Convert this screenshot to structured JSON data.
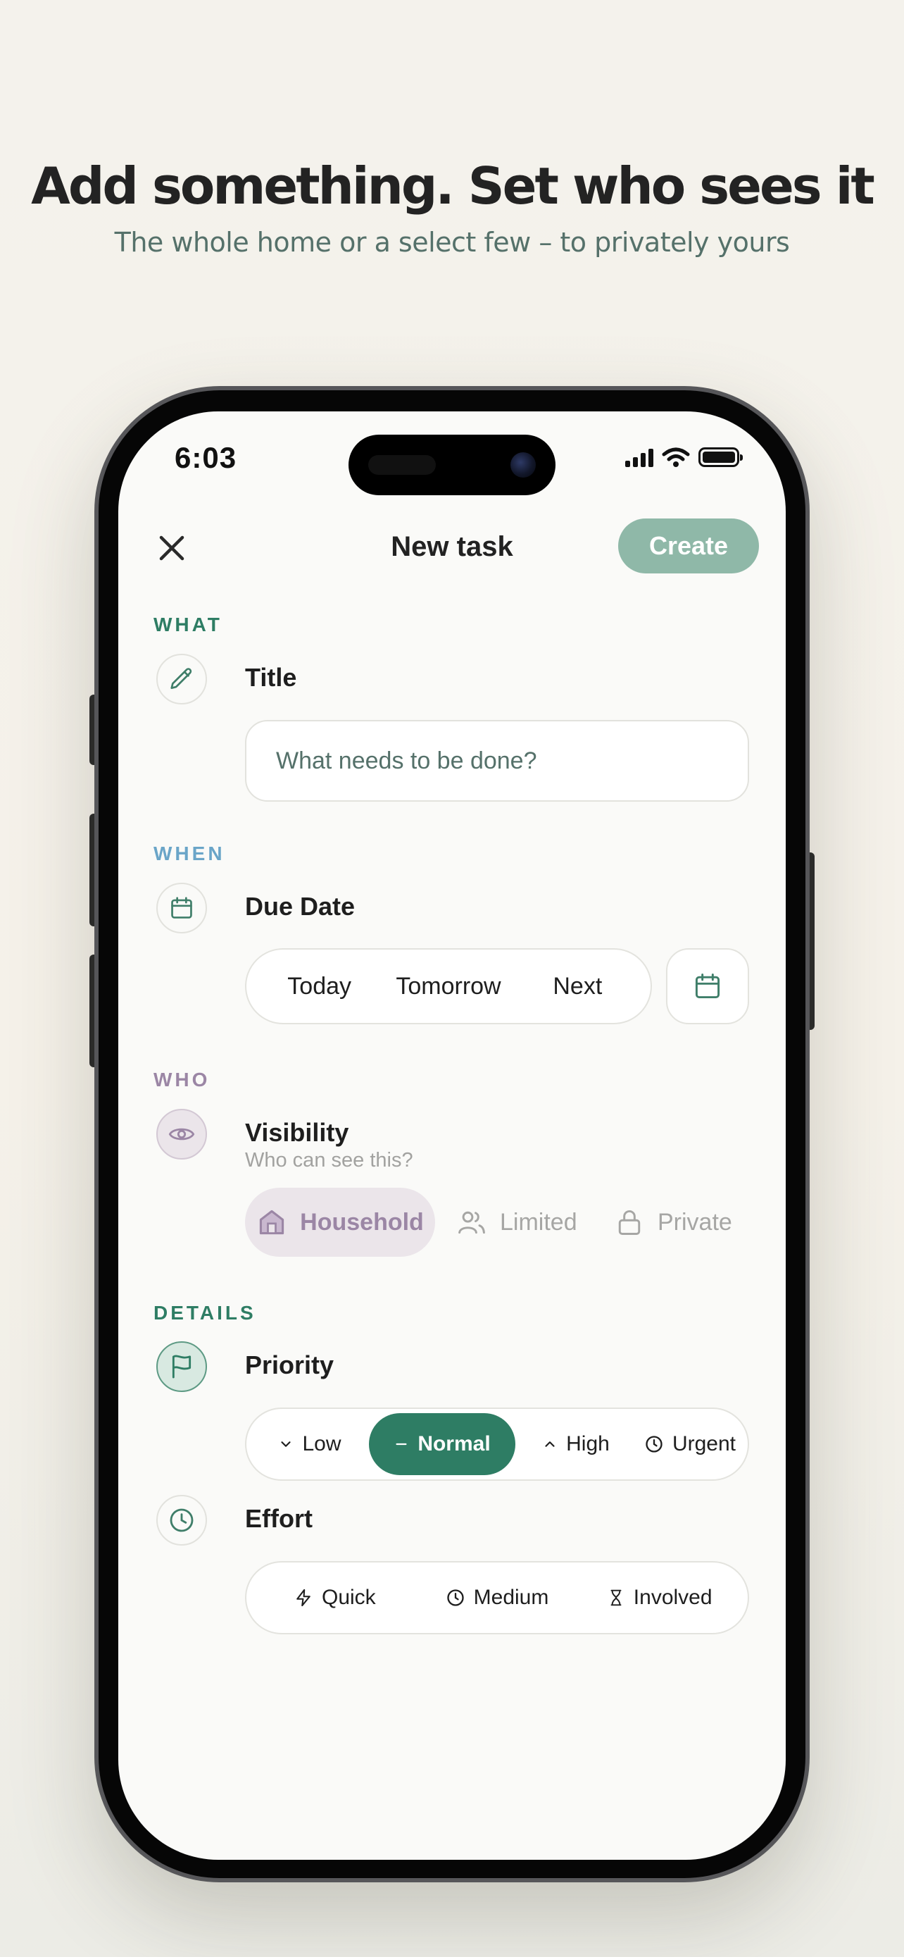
{
  "marketing": {
    "headline": "Add something. Set who sees it",
    "subline": "The whole home or a select few – to privately yours"
  },
  "status_bar": {
    "time": "6:03",
    "icons": [
      "cellular-signal-icon",
      "wifi-icon",
      "battery-icon"
    ]
  },
  "nav": {
    "close_icon": "close-icon",
    "title": "New task",
    "create_label": "Create"
  },
  "what": {
    "section_label": "WHAT",
    "icon": "pencil-icon",
    "field_title": "Title",
    "input_value": "",
    "input_placeholder": "What needs to be done?"
  },
  "when": {
    "section_label": "WHEN",
    "icon": "calendar-icon",
    "field_title": "Due Date",
    "options": [
      "Today",
      "Tomorrow",
      "Next"
    ],
    "picker_icon": "calendar-icon"
  },
  "who": {
    "section_label": "WHO",
    "icon": "eye-icon",
    "field_title": "Visibility",
    "hint": "Who can see this?",
    "options": [
      {
        "label": "Household",
        "icon": "home-icon",
        "selected": true
      },
      {
        "label": "Limited",
        "icon": "users-icon",
        "selected": false
      },
      {
        "label": "Private",
        "icon": "lock-icon",
        "selected": false
      }
    ]
  },
  "details": {
    "section_label": "DETAILS",
    "priority": {
      "icon": "flag-icon",
      "field_title": "Priority",
      "options": [
        {
          "label": "Low",
          "icon": "chevron-down-icon",
          "selected": false
        },
        {
          "label": "Normal",
          "icon": "minus-icon",
          "selected": true
        },
        {
          "label": "High",
          "icon": "chevron-up-icon",
          "selected": false
        },
        {
          "label": "Urgent",
          "icon": "clock-icon",
          "selected": false
        }
      ]
    },
    "effort": {
      "icon": "clock-icon",
      "field_title": "Effort",
      "options": [
        {
          "label": "Quick",
          "icon": "lightning-icon"
        },
        {
          "label": "Medium",
          "icon": "clock-icon"
        },
        {
          "label": "Involved",
          "icon": "hourglass-icon"
        }
      ]
    }
  },
  "colors": {
    "accent_green": "#2e7d64",
    "create_disabled": "#8fb8a8",
    "when_label": "#6aa5c8",
    "who_label": "#9b86a5",
    "headline_text": "#232323",
    "subline_text": "#55716a"
  }
}
